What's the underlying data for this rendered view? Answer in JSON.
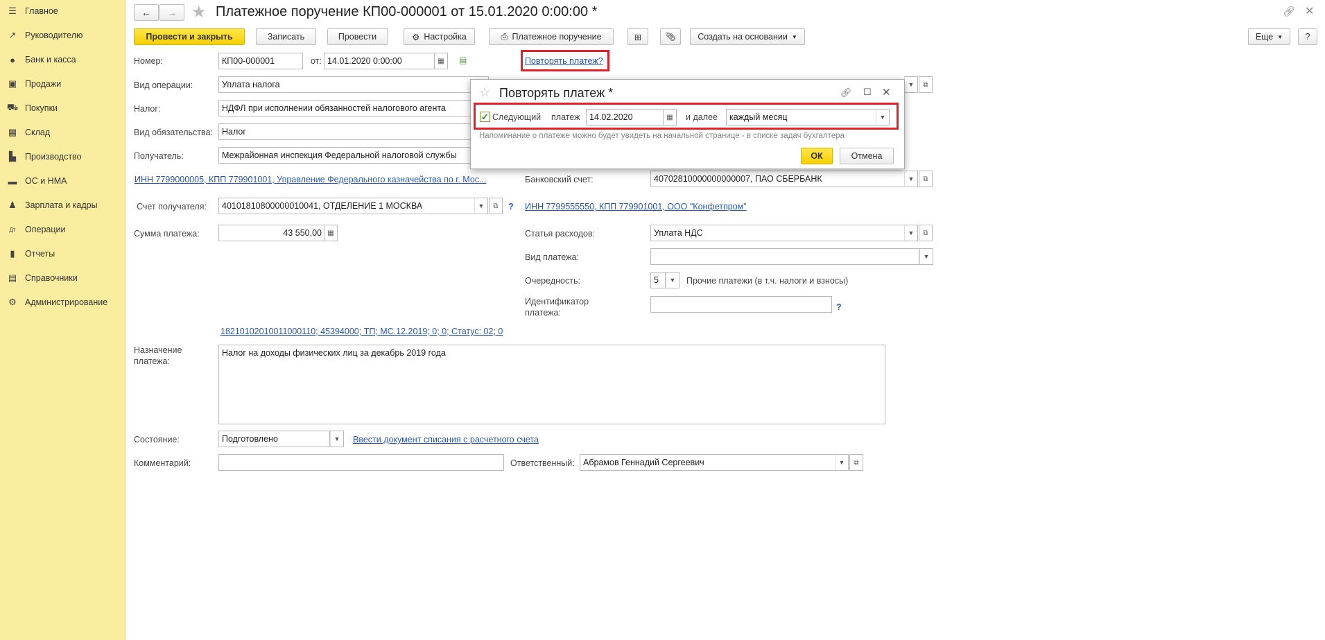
{
  "sidebar": {
    "items": [
      {
        "label": "Главное",
        "icon": "menu-icon"
      },
      {
        "label": "Руководителю",
        "icon": "trend-icon"
      },
      {
        "label": "Банк и касса",
        "icon": "coin-icon"
      },
      {
        "label": "Продажи",
        "icon": "bag-icon"
      },
      {
        "label": "Покупки",
        "icon": "cart-icon"
      },
      {
        "label": "Склад",
        "icon": "grid-icon"
      },
      {
        "label": "Производство",
        "icon": "factory-icon"
      },
      {
        "label": "ОС и НМА",
        "icon": "truck-icon"
      },
      {
        "label": "Зарплата и кадры",
        "icon": "person-icon"
      },
      {
        "label": "Операции",
        "icon": "dtkt-icon"
      },
      {
        "label": "Отчеты",
        "icon": "bar-chart-icon"
      },
      {
        "label": "Справочники",
        "icon": "book-icon"
      },
      {
        "label": "Администрирование",
        "icon": "gear-icon"
      }
    ]
  },
  "header": {
    "title": "Платежное поручение КП00-000001 от 15.01.2020 0:00:00 *"
  },
  "toolbar": {
    "post_close": "Провести и закрыть",
    "save": "Записать",
    "post": "Провести",
    "settings": "Настройка",
    "payment_order": "Платежное поручение",
    "create_based": "Создать на основании",
    "more": "Еще",
    "help": "?"
  },
  "form": {
    "number_label": "Номер:",
    "number": "КП00-000001",
    "from_label": "от:",
    "date": "14.01.2020  0:00:00",
    "repeat_link": "Повторять платеж?",
    "operation_label": "Вид операции:",
    "operation": "Уплата налога",
    "tax_label": "Налог:",
    "tax": "НДФЛ при исполнении обязанностей налогового агента",
    "obligation_label": "Вид обязательства:",
    "obligation": "Налог",
    "recipient_label": "Получатель:",
    "recipient": "Межрайонная инспекция Федеральной налоговой службы",
    "recipient_inn_link": "ИНН 7799000005, КПП 779901001, Управление Федерального казначейства по г. Мос...",
    "bank_account_label": "Банковский счет:",
    "bank_account": "40702810000000000007, ПАО СБЕРБАНК",
    "recipient_account_label": "Счет получателя:",
    "recipient_account": "40101810800000010041, ОТДЕЛЕНИЕ 1 МОСКВА",
    "payer_inn_link": "ИНН 7799555550, КПП 779901001, ООО \"Конфетпром\"",
    "amount_label": "Сумма платежа:",
    "amount": "43 550,00",
    "expense_label": "Статья расходов:",
    "expense": "Уплата НДС",
    "payment_type_label": "Вид платежа:",
    "payment_type": "",
    "priority_label": "Очередность:",
    "priority": "5",
    "priority_note": "Прочие платежи (в т.ч. налоги и взносы)",
    "identifier_label_1": "Идентификатор",
    "identifier_label_2": "платежа:",
    "identifier": "",
    "help_mark": "?",
    "kbk_link": "18210102010011000110; 45394000; ТП; МС.12.2019; 0; 0; Статус: 02; 0",
    "purpose_label_1": "Назначение",
    "purpose_label_2": "платежа:",
    "purpose": "Налог на доходы физических лиц за декабрь 2019 года",
    "state_label": "Состояние:",
    "state": "Подготовлено",
    "enter_doc_link": "Ввести документ списания с расчетного счета",
    "comment_label": "Комментарий:",
    "comment": "",
    "responsible_label": "Ответственный:",
    "responsible": "Абрамов Геннадий Сергеевич"
  },
  "dialog": {
    "title": "Повторять платеж *",
    "next_label": "Следующий",
    "payment_label": "платеж",
    "next_date": "14.02.2020",
    "then_label": "и далее",
    "period": "каждый месяц",
    "hint": "Напоминание о платеже можно будет увидеть на начальной странице - в списке задач бухгалтера",
    "ok": "ОК",
    "cancel": "Отмена"
  },
  "colors": {
    "sidebar_bg": "#fbeda0",
    "primary_button": "#f5d000",
    "link": "#2a56b0",
    "highlight": "#e0202a"
  }
}
